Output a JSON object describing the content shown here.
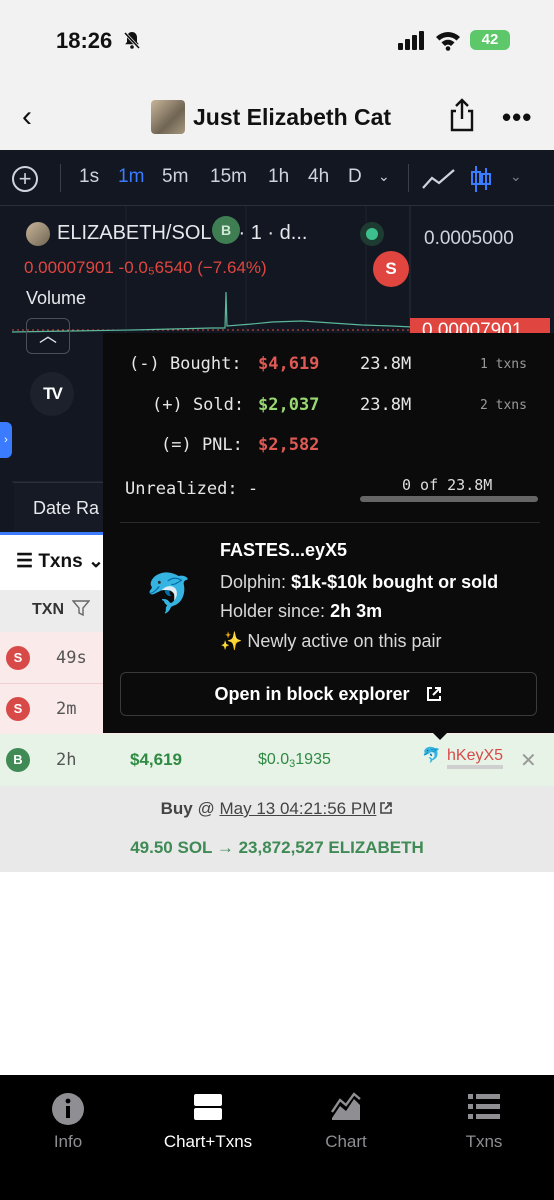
{
  "status_bar": {
    "time": "18:26",
    "battery": "42"
  },
  "header": {
    "back": "‹",
    "title": "Just Elizabeth Cat",
    "more": "•••"
  },
  "toolbar": {
    "add": "+",
    "timeframes": [
      "1s",
      "1m",
      "5m",
      "15m",
      "1h",
      "4h",
      "D"
    ],
    "active_timeframe": "1m"
  },
  "chart": {
    "pair_label": "ELIZABETH/SOL ... · 1 · d...",
    "buy_marker": "B",
    "sell_marker": "S",
    "axis_price": "0.0005000",
    "ohlc": "0.00007901 -0.0₅6540 (−7.64%)",
    "volume_label": "Volume",
    "last_price": "0.00007901",
    "tv_logo": "TV",
    "date_range_label": "Date Ra"
  },
  "txns": {
    "tab_label": "Txns",
    "col_txn": "TXN",
    "rows": [
      {
        "type": "S",
        "age": "49s"
      },
      {
        "type": "S",
        "age": "2m"
      },
      {
        "type": "B",
        "age": "2h",
        "amount": "$4,619",
        "price": "$0.0",
        "price_sub": "3",
        "price_tail": "1935",
        "maker": "hKeyX5"
      }
    ],
    "detail": {
      "action": "Buy",
      "at": "@",
      "date": "May 13 04:21:56 PM",
      "swap": "49.50 SOL → 23,872,527 ELIZABETH"
    }
  },
  "popover": {
    "bought_label": "(-) Bought:",
    "bought_value": "$4,619",
    "bought_amount": "23.8M",
    "bought_txns": "1 txns",
    "sold_label": "(+) Sold:",
    "sold_value": "$2,037",
    "sold_amount": "23.8M",
    "sold_txns": "2 txns",
    "pnl_label": "(=) PNL:",
    "pnl_value": "$2,582",
    "unrealized_label": "Unrealized: -",
    "unrealized_progress": "0 of 23.8M",
    "wallet_name": "FASTES...eyX5",
    "wallet_class_label": "Dolphin:",
    "wallet_class_value": "$1k-$10k bought or sold",
    "holder_label": "Holder since:",
    "holder_value": "2h 3m",
    "newly_active": "✨ Newly active on this pair",
    "explorer_button": "Open in block explorer"
  },
  "tabbar": {
    "items": [
      {
        "label": "Info",
        "icon": "info-icon"
      },
      {
        "label": "Chart+Txns",
        "icon": "split-view-icon"
      },
      {
        "label": "Chart",
        "icon": "area-chart-icon"
      },
      {
        "label": "Txns",
        "icon": "list-icon"
      }
    ],
    "active": "Chart+Txns"
  },
  "colors": {
    "sell": "#d84a48",
    "buy": "#3f8a55",
    "accent": "#3a7bff",
    "chart_bg": "#121722"
  }
}
